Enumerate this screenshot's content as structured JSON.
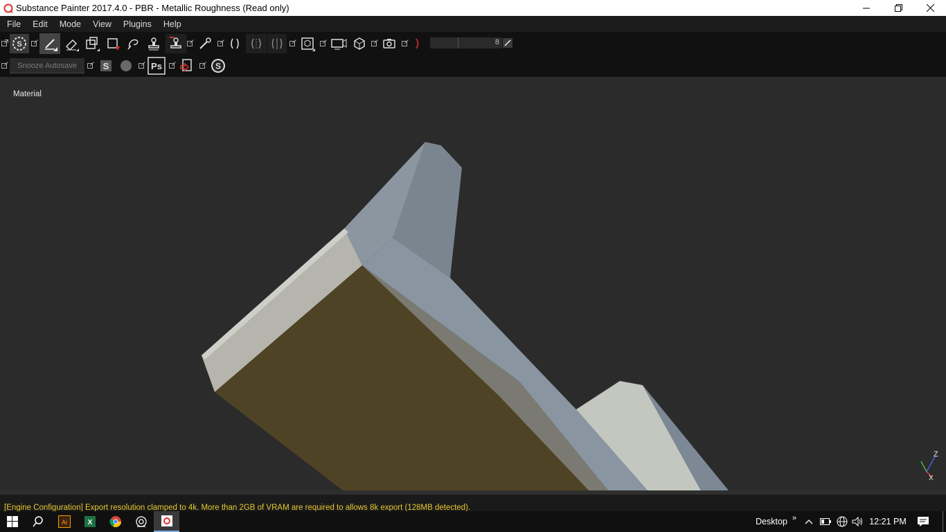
{
  "window": {
    "title": "Substance Painter 2017.4.0 - PBR - Metallic Roughness (Read only)"
  },
  "menu": {
    "items": [
      "File",
      "Edit",
      "Mode",
      "View",
      "Plugins",
      "Help"
    ]
  },
  "toolbar": {
    "brush_size_value": "8",
    "snooze_label": "Snooze Autosave"
  },
  "viewport": {
    "label": "Material",
    "axis_z": "Z",
    "axis_x": "X"
  },
  "status": {
    "message": "[Engine Configuration] Export resolution clamped to 4k. More than 2GB of VRAM are required to allows 8k export (128MB detected)."
  },
  "taskbar": {
    "desktop_label": "Desktop",
    "overflow_label": "»",
    "time": "12:21 PM"
  },
  "colors": {
    "status_text": "#e8c92e",
    "viewport_bg": "#2b2b2b",
    "toolbar_bg": "#111111",
    "app_accent": "#d9342b"
  }
}
